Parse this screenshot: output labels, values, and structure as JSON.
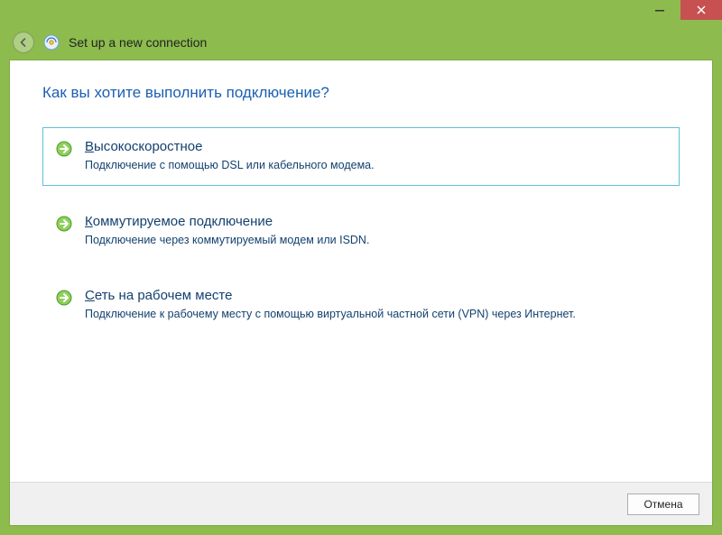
{
  "window": {
    "title": "Set up a new connection"
  },
  "heading": "Как вы хотите выполнить подключение?",
  "options": [
    {
      "accel": "В",
      "rest": "ысокоскоростное",
      "desc": "Подключение с помощью DSL или кабельного модема."
    },
    {
      "accel": "К",
      "rest": "оммутируемое подключение",
      "desc": "Подключение через коммутируемый модем или ISDN."
    },
    {
      "accel": "С",
      "rest": "еть на рабочем месте",
      "desc": "Подключение к рабочему месту с помощью виртуальной частной сети (VPN) через Интернет."
    }
  ],
  "footer": {
    "cancel": "Отмена"
  }
}
